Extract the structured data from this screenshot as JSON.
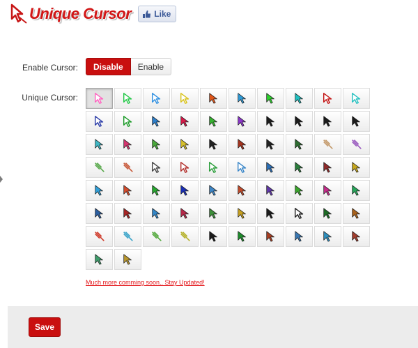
{
  "header": {
    "logo_text": "Unique Cursor",
    "like_label": "Like",
    "brand_color": "#d11616"
  },
  "settings": {
    "enable_label": "Enable Cursor:",
    "disable_option": "Disable",
    "enable_option": "Enable",
    "selected_option": "Disable",
    "cursor_label": "Unique Cursor:"
  },
  "cursors": [
    [
      "#ff63c0",
      "outline"
    ],
    [
      "#26c84a",
      "outline"
    ],
    [
      "#2f8fe0",
      "outline"
    ],
    [
      "#d8c21b",
      "outline"
    ],
    [
      "#e0561a",
      "solid"
    ],
    [
      "#2f9ad6",
      "solid"
    ],
    [
      "#2ccf2c",
      "solid"
    ],
    [
      "#20c0c0",
      "solid"
    ],
    [
      "#c31616",
      "outline"
    ],
    [
      "#26c0c0",
      "outline"
    ],
    [
      "#2d3ea8",
      "outline"
    ],
    [
      "#1e9b2a",
      "outline"
    ],
    [
      "#2d7fcb",
      "solid"
    ],
    [
      "#d71b4a",
      "solid"
    ],
    [
      "#35b12f",
      "solid"
    ],
    [
      "#8a35c8",
      "solid"
    ],
    [
      "#1b1b1b",
      "solid"
    ],
    [
      "#1b1b1b",
      "solid"
    ],
    [
      "#1b1b1b",
      "solid"
    ],
    [
      "#1b1b1b",
      "solid"
    ],
    [
      "#3fb7c4",
      "solid"
    ],
    [
      "#d5366f",
      "solid"
    ],
    [
      "#49a93a",
      "solid"
    ],
    [
      "#d6c02b",
      "solid"
    ],
    [
      "#222222",
      "solid"
    ],
    [
      "#a6341f",
      "solid"
    ],
    [
      "#222222",
      "solid"
    ],
    [
      "#2d6d31",
      "solid"
    ],
    [
      "#c49a6c",
      "feather"
    ],
    [
      "#9a5bbf",
      "feather"
    ],
    [
      "#59a94c",
      "feather"
    ],
    [
      "#c85a3b",
      "feather"
    ],
    [
      "#444444",
      "outline"
    ],
    [
      "#b2302c",
      "outline"
    ],
    [
      "#2a9d3a",
      "outline"
    ],
    [
      "#3a86c8",
      "outline"
    ],
    [
      "#2c6fb6",
      "solid"
    ],
    [
      "#2b7f3d",
      "solid"
    ],
    [
      "#8e2a2a",
      "solid"
    ],
    [
      "#c7a81d",
      "solid"
    ],
    [
      "#2f9fd8",
      "solid"
    ],
    [
      "#d34b2c",
      "solid"
    ],
    [
      "#27a82f",
      "solid"
    ],
    [
      "#1a2fb5",
      "solid"
    ],
    [
      "#3e86c6",
      "solid"
    ],
    [
      "#c14a2b",
      "solid"
    ],
    [
      "#6038a8",
      "solid"
    ],
    [
      "#3aa62c",
      "solid"
    ],
    [
      "#c42b8a",
      "solid"
    ],
    [
      "#27a65a",
      "solid"
    ],
    [
      "#2c5fa0",
      "solid"
    ],
    [
      "#a52626",
      "solid"
    ],
    [
      "#3486c6",
      "solid"
    ],
    [
      "#b62a4a",
      "solid"
    ],
    [
      "#3e8f3a",
      "solid"
    ],
    [
      "#c7a020",
      "solid"
    ],
    [
      "#1c1c1c",
      "solid"
    ],
    [
      "#ffffff",
      "outline"
    ],
    [
      "#1c6a25",
      "solid"
    ],
    [
      "#a8621c",
      "solid"
    ],
    [
      "#cf3b2b",
      "feather"
    ],
    [
      "#3aa4c9",
      "feather"
    ],
    [
      "#52a83b",
      "feather"
    ],
    [
      "#b5b12a",
      "feather"
    ],
    [
      "#1c1c1c",
      "solid"
    ],
    [
      "#1e8c2c",
      "solid"
    ],
    [
      "#a73e22",
      "solid"
    ],
    [
      "#3a78b3",
      "solid"
    ],
    [
      "#2e8fbe",
      "solid"
    ],
    [
      "#a23d2d",
      "solid"
    ],
    [
      "#3d9c6a",
      "solid"
    ],
    [
      "#b8962d",
      "solid"
    ]
  ],
  "selected_index": 0,
  "notice": "Much more comming soon.. Stay Updated!",
  "footer": {
    "save_label": "Save"
  },
  "colors": {
    "accent": "#c90f0f",
    "link": "#e4161a",
    "footer_bg": "#ececec"
  }
}
